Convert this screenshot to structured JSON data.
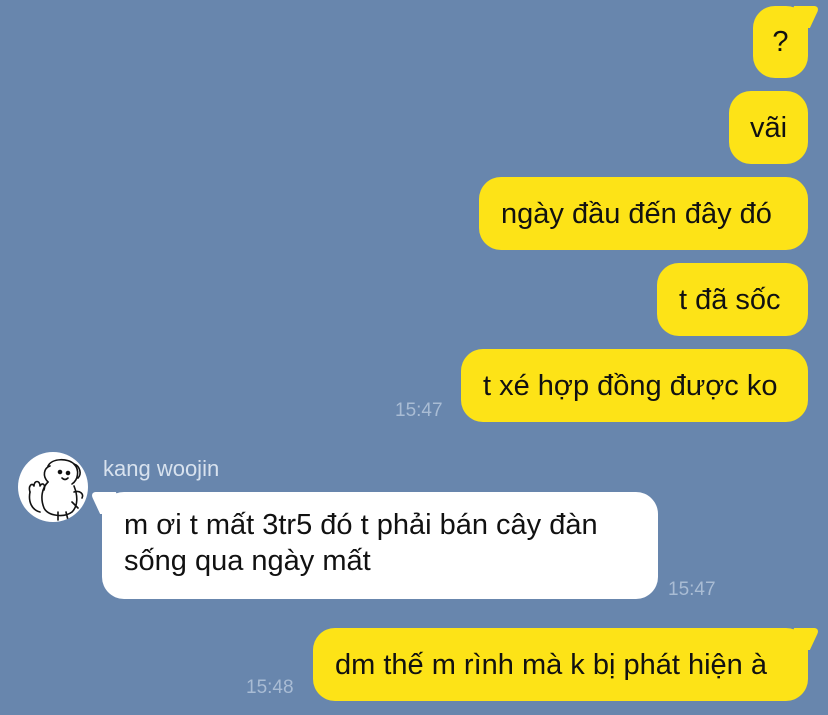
{
  "chat": {
    "outgoing": [
      {
        "text": "?"
      },
      {
        "text": "vãi"
      },
      {
        "text": "ngày đầu đến đây đó"
      },
      {
        "text": "t đã sốc"
      },
      {
        "text": "t xé hợp đồng được ko"
      }
    ],
    "outgoing_time_1": "15:47",
    "incoming": {
      "sender": "kang woojin",
      "avatar_icon": "dog-sketch-avatar",
      "lines": [
        "m ơi t mất 3tr5 đó t phải bán cây đàn",
        "sống qua ngày mất"
      ],
      "time": "15:47"
    },
    "last_outgoing": {
      "text": "dm thế m rình mà k bị phát hiện à",
      "time": "15:48"
    }
  },
  "colors": {
    "background": "#6886ad",
    "outgoing_bubble": "#fde317",
    "incoming_bubble": "#ffffff",
    "timestamp": "#a9bcd4"
  }
}
